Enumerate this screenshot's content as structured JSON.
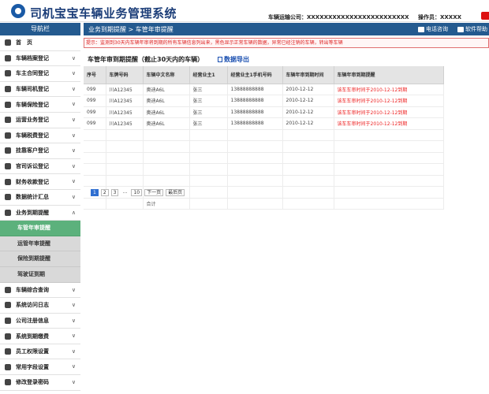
{
  "header": {
    "title": "司机宝宝车辆业务管理系统",
    "company": "车辆运输公司：XXXXXXXXXXXXXXXXXXXXXXXX",
    "operator": "操作员：XXXXX"
  },
  "sidebar": {
    "title": "导航栏",
    "items_top": [
      {
        "label": "首　页",
        "icon": "home-icon",
        "arrow": ""
      },
      {
        "label": "车辆档案登记",
        "icon": "archive-icon",
        "arrow": "∨"
      },
      {
        "label": "车主合同登记",
        "icon": "contract-icon",
        "arrow": "∨"
      },
      {
        "label": "车辆司机登记",
        "icon": "driver-icon",
        "arrow": "∨"
      },
      {
        "label": "车辆保险登记",
        "icon": "insurance-icon",
        "arrow": "∨"
      },
      {
        "label": "运营业务登记",
        "icon": "monitor-icon",
        "arrow": "∨"
      },
      {
        "label": "车辆税费登记",
        "icon": "tax-icon",
        "arrow": "∨"
      },
      {
        "label": "挂靠客户登记",
        "icon": "client-icon",
        "arrow": "∨"
      },
      {
        "label": "官司诉讼登记",
        "icon": "lawsuit-icon",
        "arrow": "∨"
      },
      {
        "label": "财务收款登记",
        "icon": "finance-icon",
        "arrow": "∨"
      },
      {
        "label": "数据统计汇总",
        "icon": "stats-icon",
        "arrow": "∨"
      },
      {
        "label": "业务到期提醒",
        "icon": "reminder-icon",
        "arrow": "∧"
      }
    ],
    "sub_items": [
      {
        "label": "车管年审提醒",
        "active": true
      },
      {
        "label": "运管年审提醒",
        "active": false
      },
      {
        "label": "保险到期提醒",
        "active": false
      },
      {
        "label": "驾驶证到期",
        "active": false
      }
    ],
    "items_bottom": [
      {
        "label": "车辆综合查询",
        "icon": "search-icon",
        "arrow": "∨"
      },
      {
        "label": "系统访问日志",
        "icon": "log-icon",
        "arrow": "∨"
      },
      {
        "label": "公司注册信息",
        "icon": "company-icon",
        "arrow": "∨"
      },
      {
        "label": "系统到期缴费",
        "icon": "payment-icon",
        "arrow": "∨"
      },
      {
        "label": "员工权限设置",
        "icon": "permission-icon",
        "arrow": "∨"
      },
      {
        "label": "常用字段设置",
        "icon": "settings-icon",
        "arrow": "∨"
      },
      {
        "label": "修改登录密码",
        "icon": "lock-icon",
        "arrow": "∨"
      }
    ]
  },
  "topbar": {
    "breadcrumb": "业务到期提醒 > 车管年审提醒",
    "phone_label": "电话咨询",
    "help_label": "软件帮助"
  },
  "notice": "提示：监测到30天内车辆年审将到期的所有车辆信息列出来，黑色显示正常车辆的数据，异常已经注销的车辆，转出等车辆",
  "content": {
    "title": "车管年审到期提醒（截止30天内的车辆）",
    "export_label": "数据导出",
    "columns": [
      "序号",
      "车牌号码",
      "车辆中文名称",
      "经营业主1",
      "经营业主1手机号码",
      "车辆年审到期时间",
      "车辆年审到期提醒"
    ],
    "rows": [
      [
        "099",
        "川A12345",
        "奥迪A6L",
        "张三",
        "13888888888",
        "2010-12-12",
        "该车车审时间于2010-12-12到期"
      ],
      [
        "099",
        "川A12345",
        "奥迪A6L",
        "张三",
        "13888888888",
        "2010-12-12",
        "该车车审时间于2010-12-12到期"
      ],
      [
        "099",
        "川A12345",
        "奥迪A6L",
        "张三",
        "13888888888",
        "2010-12-12",
        "该车车审时间于2010-12-12到期"
      ],
      [
        "099",
        "川A12345",
        "奥迪A6L",
        "张三",
        "13888888888",
        "2010-12-12",
        "该车车审时间于2010-12-12到期"
      ]
    ],
    "total_label": "合计",
    "pager": [
      "1",
      "2",
      "3",
      "…",
      "10",
      "下一页",
      "最后页"
    ],
    "pager_active": "1"
  },
  "colors": {
    "nav_blue": "#245a8f",
    "active_green": "#5cb17c",
    "alert_red": "#e22222",
    "title_blue": "#1b3d78"
  }
}
